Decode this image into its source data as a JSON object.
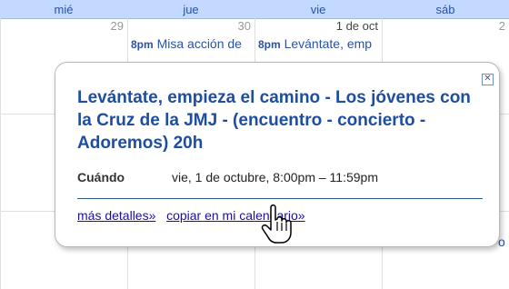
{
  "header": {
    "days": [
      "mié",
      "jue",
      "vie",
      "sáb"
    ]
  },
  "dates": [
    "29",
    "30",
    "1 de oct",
    "2"
  ],
  "events": [
    {
      "time": "8pm",
      "title": "Misa acción de"
    },
    {
      "time": "8pm",
      "title": "Levántate, emp"
    }
  ],
  "popup": {
    "title": "Levántate, empieza el camino - Los jóvenes con la Cruz de la JMJ - (encuentro - concierto - Adoremos) 20h",
    "when_label": "Cuándo",
    "when_value": "vie, 1 de octubre, 8:00pm – 11:59pm",
    "more_details": "más detalles»",
    "copy_calendar": "copiar en mi calendario»",
    "close_icon": "close-icon"
  },
  "side_fragment": "o"
}
